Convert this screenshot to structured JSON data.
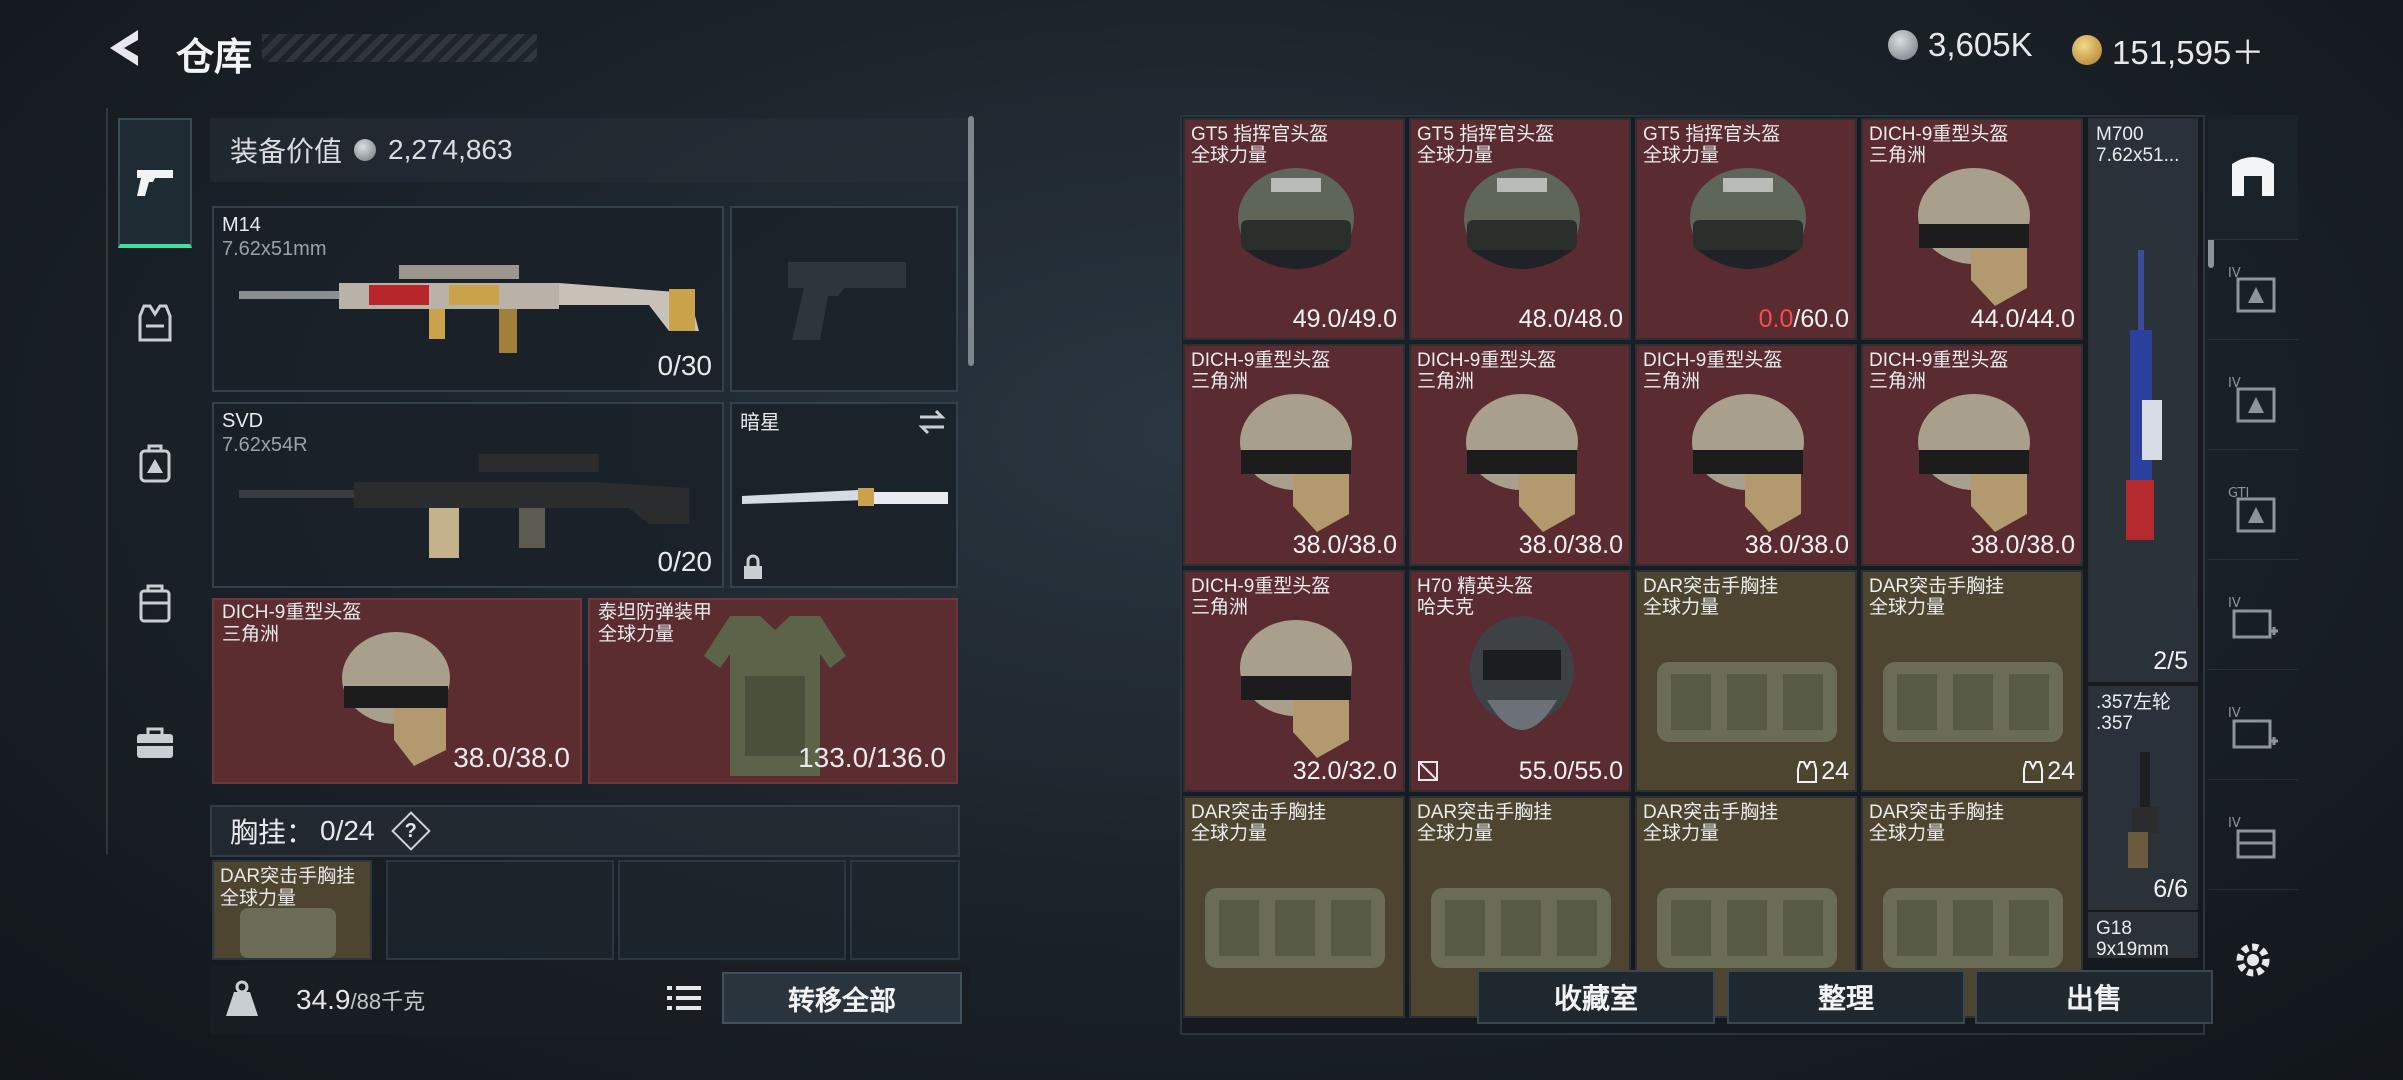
{
  "header": {
    "title": "仓库",
    "currency_silver": "3,605K",
    "currency_gold": "151,595＋"
  },
  "sidebar": {
    "tabs": [
      {
        "icon": "pistol-icon",
        "active": true
      },
      {
        "icon": "vest-icon",
        "active": false
      },
      {
        "icon": "backpack-icon",
        "active": false
      },
      {
        "icon": "bag-icon",
        "active": false
      },
      {
        "icon": "toolbox-icon",
        "active": false
      }
    ]
  },
  "loadout": {
    "equip_value_label": "装备价值",
    "equip_value": "2,274,863",
    "primary": {
      "name": "M14",
      "caliber": "7.62x51mm",
      "ammo": "0/30"
    },
    "secondary": {
      "name": "SVD",
      "caliber": "7.62x54R",
      "ammo": "0/20"
    },
    "melee": {
      "name": "暗星"
    },
    "helmet": {
      "name": "DICH-9重型头盔",
      "sub": "三角洲",
      "durability": "38.0/38.0"
    },
    "armor": {
      "name": "泰坦防弹装甲",
      "sub": "全球力量",
      "durability": "133.0/136.0"
    },
    "vest_label": "胸挂：",
    "vest_capacity": "0/24",
    "vest_help": "?",
    "vest_slot": {
      "name": "DAR突击手胸挂",
      "sub": "全球力量"
    },
    "weight": "34.9",
    "weight_max": "/88千克",
    "transfer_all": "转移全部"
  },
  "storage": {
    "grid": [
      {
        "name": "GT5 指挥官头盔",
        "sub": "全球力量",
        "dur_a": "49.0",
        "dur_b": "/49.0",
        "bad": false,
        "type": "helmet-gt5",
        "bg": "red"
      },
      {
        "name": "GT5 指挥官头盔",
        "sub": "全球力量",
        "dur_a": "48.0",
        "dur_b": "/48.0",
        "bad": false,
        "type": "helmet-gt5",
        "bg": "red"
      },
      {
        "name": "GT5 指挥官头盔",
        "sub": "全球力量",
        "dur_a": "0.0",
        "dur_b": "/60.0",
        "bad": true,
        "type": "helmet-gt5",
        "bg": "red"
      },
      {
        "name": "DICH-9重型头盔",
        "sub": "三角洲",
        "dur_a": "44.0",
        "dur_b": "/44.0",
        "bad": false,
        "type": "helmet-dich",
        "bg": "red"
      },
      {
        "name": "DICH-9重型头盔",
        "sub": "三角洲",
        "dur_a": "38.0",
        "dur_b": "/38.0",
        "bad": false,
        "type": "helmet-dich",
        "bg": "red"
      },
      {
        "name": "DICH-9重型头盔",
        "sub": "三角洲",
        "dur_a": "38.0",
        "dur_b": "/38.0",
        "bad": false,
        "type": "helmet-dich",
        "bg": "red"
      },
      {
        "name": "DICH-9重型头盔",
        "sub": "三角洲",
        "dur_a": "38.0",
        "dur_b": "/38.0",
        "bad": false,
        "type": "helmet-dich",
        "bg": "red"
      },
      {
        "name": "DICH-9重型头盔",
        "sub": "三角洲",
        "dur_a": "38.0",
        "dur_b": "/38.0",
        "bad": false,
        "type": "helmet-dich",
        "bg": "red"
      },
      {
        "name": "DICH-9重型头盔",
        "sub": "三角洲",
        "dur_a": "32.0",
        "dur_b": "/32.0",
        "bad": false,
        "type": "helmet-dich",
        "bg": "red"
      },
      {
        "name": "H70 精英头盔",
        "sub": "哈夫克",
        "dur_a": "55.0",
        "dur_b": "/55.0",
        "bad": false,
        "type": "helmet-h70",
        "bg": "red",
        "lock": true
      },
      {
        "name": "DAR突击手胸挂",
        "sub": "全球力量",
        "stack": "24",
        "type": "vest",
        "bg": "olive"
      },
      {
        "name": "DAR突击手胸挂",
        "sub": "全球力量",
        "stack": "24",
        "type": "vest",
        "bg": "olive"
      },
      {
        "name": "DAR突击手胸挂",
        "sub": "全球力量",
        "type": "vest",
        "bg": "olive"
      },
      {
        "name": "DAR突击手胸挂",
        "sub": "全球力量",
        "type": "vest",
        "bg": "olive"
      },
      {
        "name": "DAR突击手胸挂",
        "sub": "全球力量",
        "type": "vest",
        "bg": "olive"
      },
      {
        "name": "DAR突击手胸挂",
        "sub": "全球力量",
        "type": "vest",
        "bg": "olive"
      }
    ],
    "side_items": [
      {
        "name": "M700",
        "sub": "7.62x51...",
        "count": "2/5"
      },
      {
        "name": ".357左轮",
        "sub": ".357",
        "count": "6/6"
      },
      {
        "name": "G18",
        "sub": "9x19mm",
        "count": ""
      }
    ],
    "buttons": {
      "collection": "收藏室",
      "sort": "整理",
      "sell": "出售"
    }
  },
  "right_strip": {
    "items": [
      {
        "icon": "container-icon",
        "label": ""
      },
      {
        "icon": "case-icon",
        "label": "IV"
      },
      {
        "icon": "case-icon",
        "label": "IV"
      },
      {
        "icon": "case-icon",
        "label": "GTI"
      },
      {
        "icon": "medkit-case-icon",
        "label": "IV"
      },
      {
        "icon": "medkit-case-icon",
        "label": "IV"
      },
      {
        "icon": "case-icon",
        "label": "IV"
      }
    ]
  }
}
